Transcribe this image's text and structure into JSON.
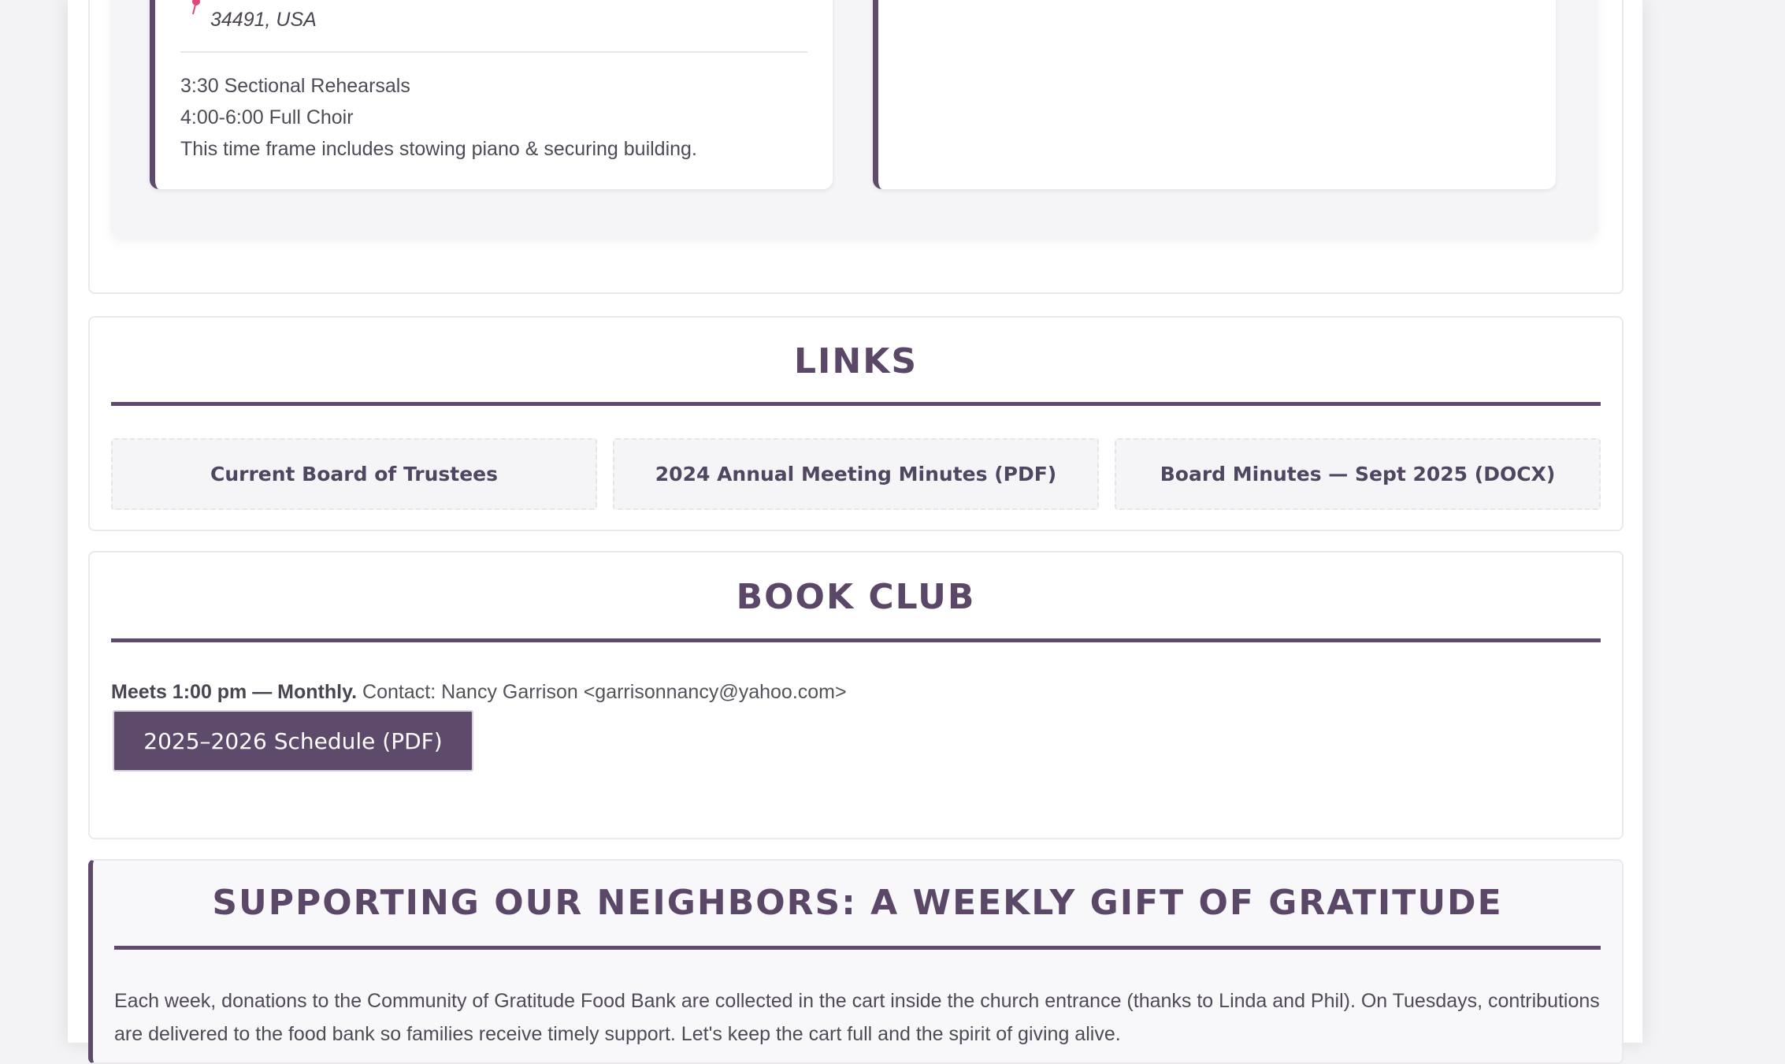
{
  "event": {
    "address_tail": "34491, USA",
    "schedule": [
      "3:30 Sectional Rehearsals",
      "4:00-6:00 Full Choir",
      "This time frame includes stowing piano & securing building."
    ]
  },
  "links": {
    "title": "LINKS",
    "items": [
      "Current Board of Trustees",
      "2024 Annual Meeting Minutes (PDF)",
      "Board Minutes — Sept 2025 (DOCX)"
    ]
  },
  "book_club": {
    "title": "BOOK CLUB",
    "meets_bold": "Meets 1:00 pm — Monthly.",
    "contact": " Contact: Nancy Garrison <garrisonnancy@yahoo.com>",
    "button_label": "2025–2026 Schedule (PDF)"
  },
  "support": {
    "title": "SUPPORTING OUR NEIGHBORS: A WEEKLY GIFT OF GRATITUDE",
    "text": "Each week, donations to the Community of Gratitude Food Bank are collected in the cart inside the church entrance (thanks to Linda and Phil). On Tuesdays, contributions are delivered to the food bank so families receive timely support. Let's keep the cart full and the spirit of giving alive."
  },
  "colors": {
    "accent": "#5e4a6a",
    "title": "#5b4767",
    "pin": "#e0457b"
  },
  "icons": {
    "pin": "map-pin-icon"
  }
}
